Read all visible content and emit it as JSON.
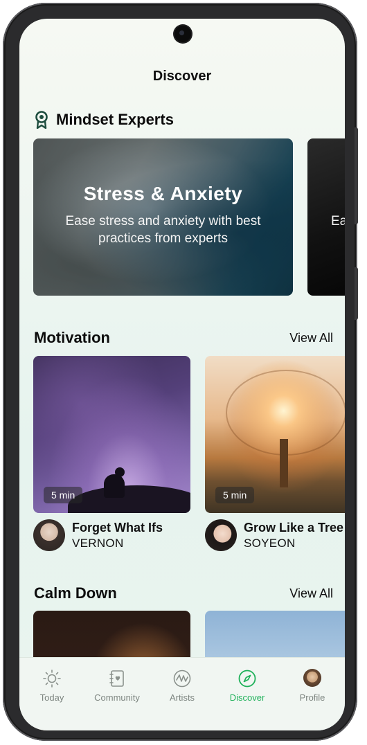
{
  "header": {
    "title": "Discover"
  },
  "mindset": {
    "section_title": "Mindset Experts",
    "cards": [
      {
        "title": "Stress & Anxiety",
        "subtitle": "Ease stress and anxiety with best practices from experts"
      },
      {
        "title": "",
        "subtitle": "Ea"
      }
    ]
  },
  "motivation": {
    "section_title": "Motivation",
    "view_all": "View All",
    "items": [
      {
        "duration": "5 min",
        "title": "Forget What Ifs",
        "artist": "VERNON"
      },
      {
        "duration": "5 min",
        "title": "Grow Like a Tree",
        "artist": "SOYEON"
      }
    ]
  },
  "calm": {
    "section_title": "Calm Down",
    "view_all": "View All"
  },
  "nav": {
    "items": [
      {
        "label": "Today",
        "icon": "sun-icon"
      },
      {
        "label": "Community",
        "icon": "journal-icon"
      },
      {
        "label": "Artists",
        "icon": "artists-icon"
      },
      {
        "label": "Discover",
        "icon": "compass-icon",
        "active": true
      },
      {
        "label": "Profile",
        "icon": "profile-avatar"
      }
    ]
  },
  "colors": {
    "accent": "#1fb15a",
    "expert_icon": "#1d4d3e",
    "inactive_nav": "#7d8580"
  }
}
